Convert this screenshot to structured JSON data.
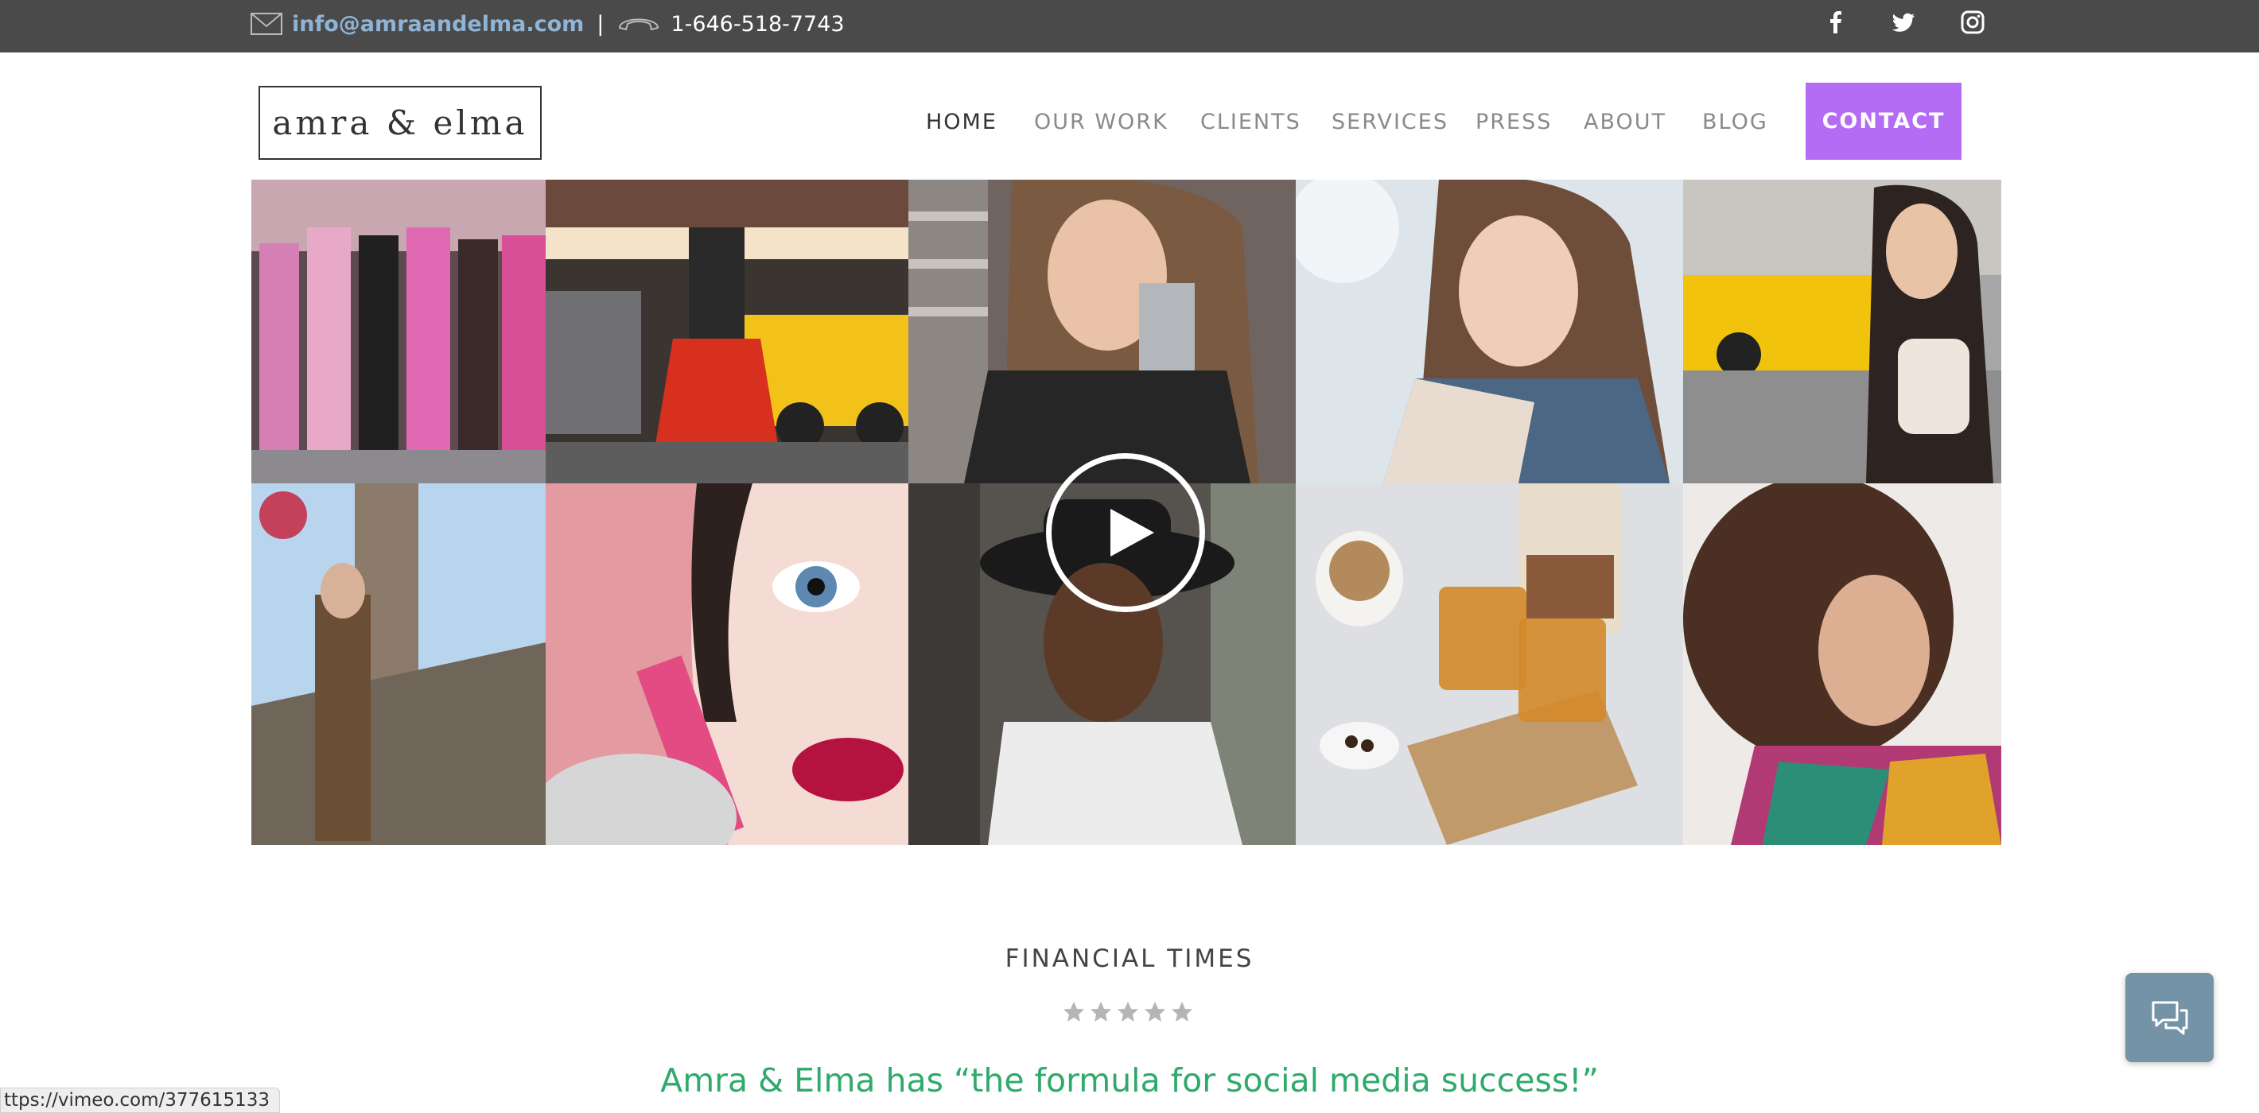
{
  "topbar": {
    "email": "info@amraandelma.com",
    "separator": "|",
    "phone": "1-646-518-7743",
    "social": [
      "facebook-icon",
      "twitter-icon",
      "instagram-icon"
    ]
  },
  "header": {
    "logo": "amra & elma",
    "nav": [
      {
        "label": "HOME",
        "active": true
      },
      {
        "label": "OUR WORK",
        "active": false
      },
      {
        "label": "CLIENTS",
        "active": false
      },
      {
        "label": "SERVICES",
        "active": false
      },
      {
        "label": "PRESS",
        "active": false
      },
      {
        "label": "ABOUT",
        "active": false
      },
      {
        "label": "BLOG",
        "active": false
      }
    ],
    "contact_label": "CONTACT"
  },
  "gallery": {
    "play_icon": "play-icon"
  },
  "press": {
    "title": "FINANCIAL TIMES",
    "rating": 5,
    "quote": "Amra & Elma has “the formula for social media success!”"
  },
  "chat": {
    "icon": "chat-icon"
  },
  "status_bar": {
    "url": "ttps://vimeo.com/377615133"
  },
  "colors": {
    "topbar": "#4a4a4a",
    "email_link": "#8fb4d6",
    "contact_button": "#b46cf5",
    "quote": "#2eaa6a",
    "chat_button": "#7593a6"
  }
}
